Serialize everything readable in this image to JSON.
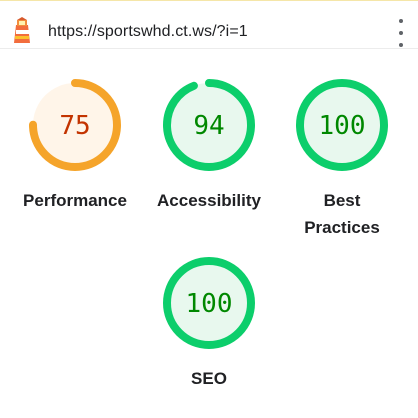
{
  "browser": {
    "url": "https://sportswhd.ct.ws/?i=1",
    "app_icon": "lighthouse-icon",
    "menu_icon": "kebab-menu-icon"
  },
  "colors": {
    "average_stroke": "#f5a42a",
    "average_fill": "#fff5e9",
    "average_text": "#c33300",
    "pass_stroke": "#0cce6b",
    "pass_fill": "#e8f8ee",
    "pass_text": "#008800"
  },
  "gauges": [
    {
      "label": "Performance",
      "score": 75,
      "status": "average"
    },
    {
      "label": "Accessibility",
      "score": 94,
      "status": "pass"
    },
    {
      "label": "Best\nPractices",
      "score": 100,
      "status": "pass"
    },
    {
      "label": "SEO",
      "score": 100,
      "status": "pass"
    }
  ]
}
